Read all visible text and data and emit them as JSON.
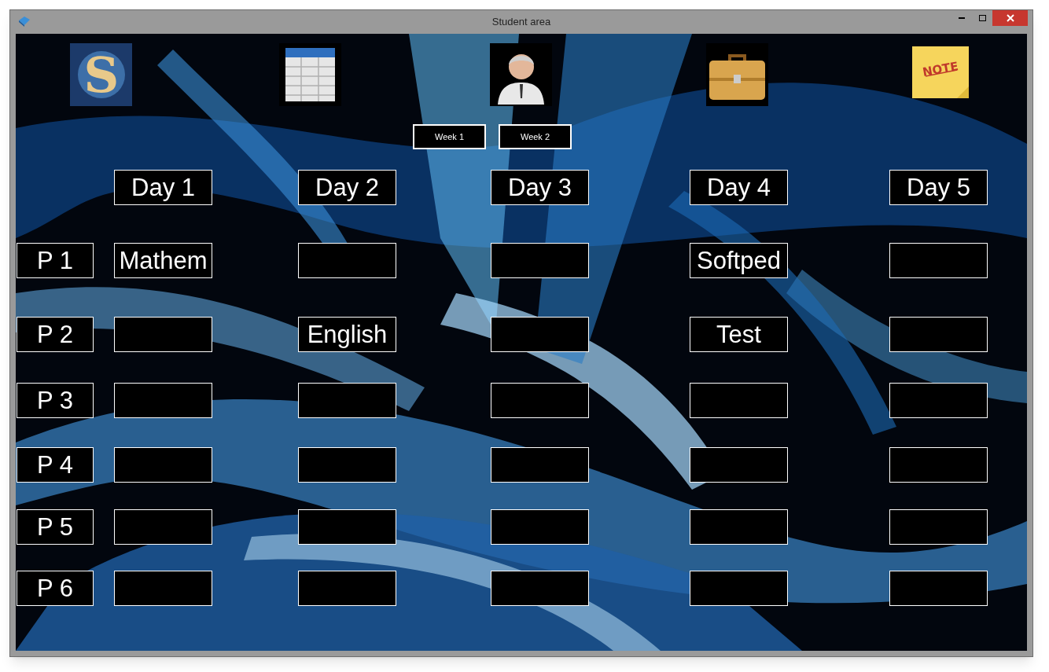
{
  "window": {
    "title": "Student area"
  },
  "toolbar": [
    {
      "kind": "logo",
      "text": "S"
    },
    {
      "kind": "table"
    },
    {
      "kind": "person"
    },
    {
      "kind": "briefcase"
    },
    {
      "kind": "note",
      "text": "NOTE"
    }
  ],
  "week_buttons": [
    "Week 1",
    "Week 2"
  ],
  "days": [
    "Day 1",
    "Day 2",
    "Day 3",
    "Day 4",
    "Day 5"
  ],
  "periods": [
    {
      "label": "P 1",
      "cells": [
        {
          "text": "Mathem"
        },
        {},
        {},
        {
          "text": "Softped"
        },
        {}
      ]
    },
    {
      "label": "P 2",
      "cells": [
        {},
        {
          "text": "English"
        },
        {},
        {
          "text": "Test"
        },
        {}
      ]
    },
    {
      "label": "P 3",
      "cells": [
        {},
        {},
        {},
        {},
        {}
      ]
    },
    {
      "label": "P 4",
      "cells": [
        {},
        {},
        {},
        {},
        {}
      ]
    },
    {
      "label": "P 5",
      "cells": [
        {},
        {},
        {},
        {},
        {}
      ]
    },
    {
      "label": "P 6",
      "cells": [
        {},
        {},
        {},
        {},
        {}
      ]
    }
  ]
}
